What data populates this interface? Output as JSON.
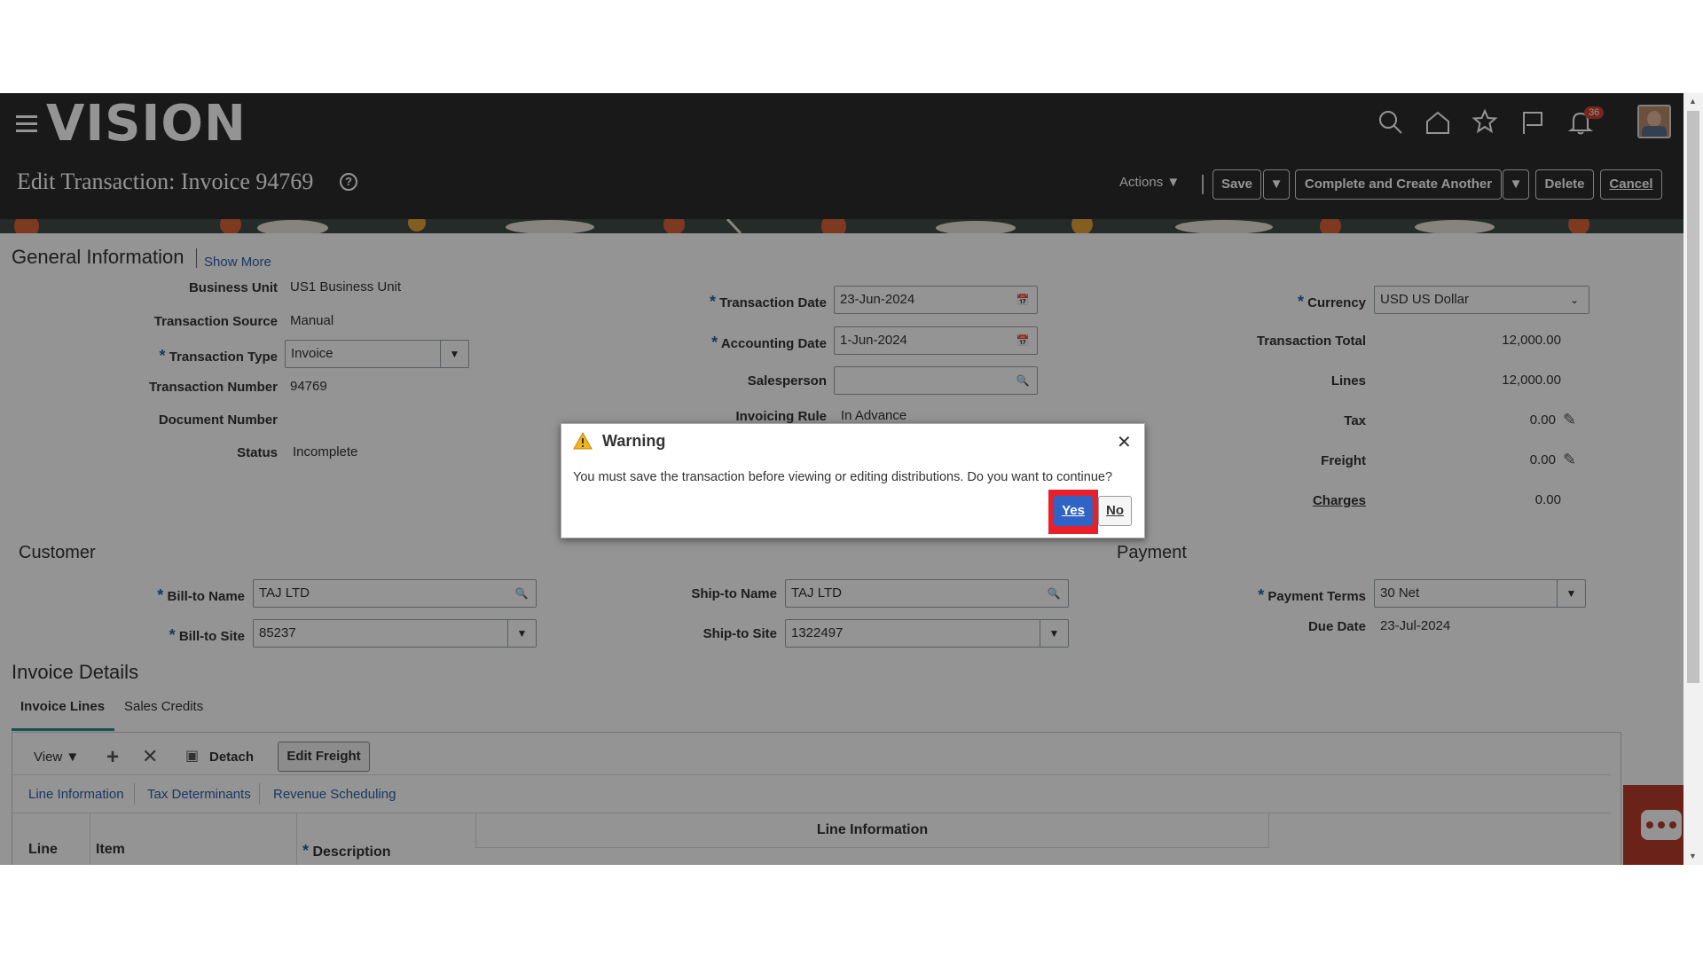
{
  "header": {
    "logo": "VISION",
    "page_title": "Edit Transaction: Invoice 94769",
    "help_glyph": "?",
    "notification_count": "36",
    "actions_label": "Actions",
    "save_label": "Save",
    "complete_label": "Complete and Create Another",
    "delete_label": "Delete",
    "cancel_label": "Cancel"
  },
  "general": {
    "title": "General Information",
    "show_more": "Show More",
    "business_unit_label": "Business Unit",
    "business_unit": "US1 Business Unit",
    "transaction_source_label": "Transaction Source",
    "transaction_source": "Manual",
    "transaction_type_label": "Transaction Type",
    "transaction_type": "Invoice",
    "transaction_number_label": "Transaction Number",
    "transaction_number": "94769",
    "document_number_label": "Document Number",
    "status_label": "Status",
    "status": "Incomplete",
    "transaction_date_label": "Transaction Date",
    "transaction_date": "23-Jun-2024",
    "accounting_date_label": "Accounting Date",
    "accounting_date": "1-Jun-2024",
    "salesperson_label": "Salesperson",
    "invoicing_rule_label": "Invoicing Rule",
    "invoicing_rule": "In Advance",
    "currency_label": "Currency",
    "currency": "USD US Dollar",
    "transaction_total_label": "Transaction Total",
    "transaction_total": "12,000.00",
    "lines_label": "Lines",
    "lines": "12,000.00",
    "tax_label": "Tax",
    "tax": "0.00",
    "freight_label": "Freight",
    "freight": "0.00",
    "charges_label": "Charges",
    "charges": "0.00"
  },
  "customer": {
    "title": "Customer",
    "bill_to_name_label": "Bill-to Name",
    "bill_to_name": "TAJ LTD",
    "bill_to_site_label": "Bill-to Site",
    "bill_to_site": "85237",
    "ship_to_name_label": "Ship-to Name",
    "ship_to_name": "TAJ LTD",
    "ship_to_site_label": "Ship-to Site",
    "ship_to_site": "1322497"
  },
  "payment": {
    "title": "Payment",
    "payment_terms_label": "Payment Terms",
    "payment_terms": "30 Net",
    "due_date_label": "Due Date",
    "due_date": "23-Jul-2024"
  },
  "invoice_details": {
    "title": "Invoice Details",
    "tabs": [
      "Invoice Lines",
      "Sales Credits"
    ],
    "view_label": "View",
    "detach_label": "Detach",
    "edit_freight_label": "Edit Freight",
    "subtabs": [
      "Line Information",
      "Tax Determinants",
      "Revenue Scheduling"
    ],
    "group_header": "Line Information",
    "columns": [
      "Line",
      "Item",
      "Description"
    ]
  },
  "dialog": {
    "title": "Warning",
    "message": "You must save the transaction before viewing or editing distributions. Do you want to continue?",
    "yes_label": "Yes",
    "no_label": "No"
  },
  "required_mark": "*"
}
